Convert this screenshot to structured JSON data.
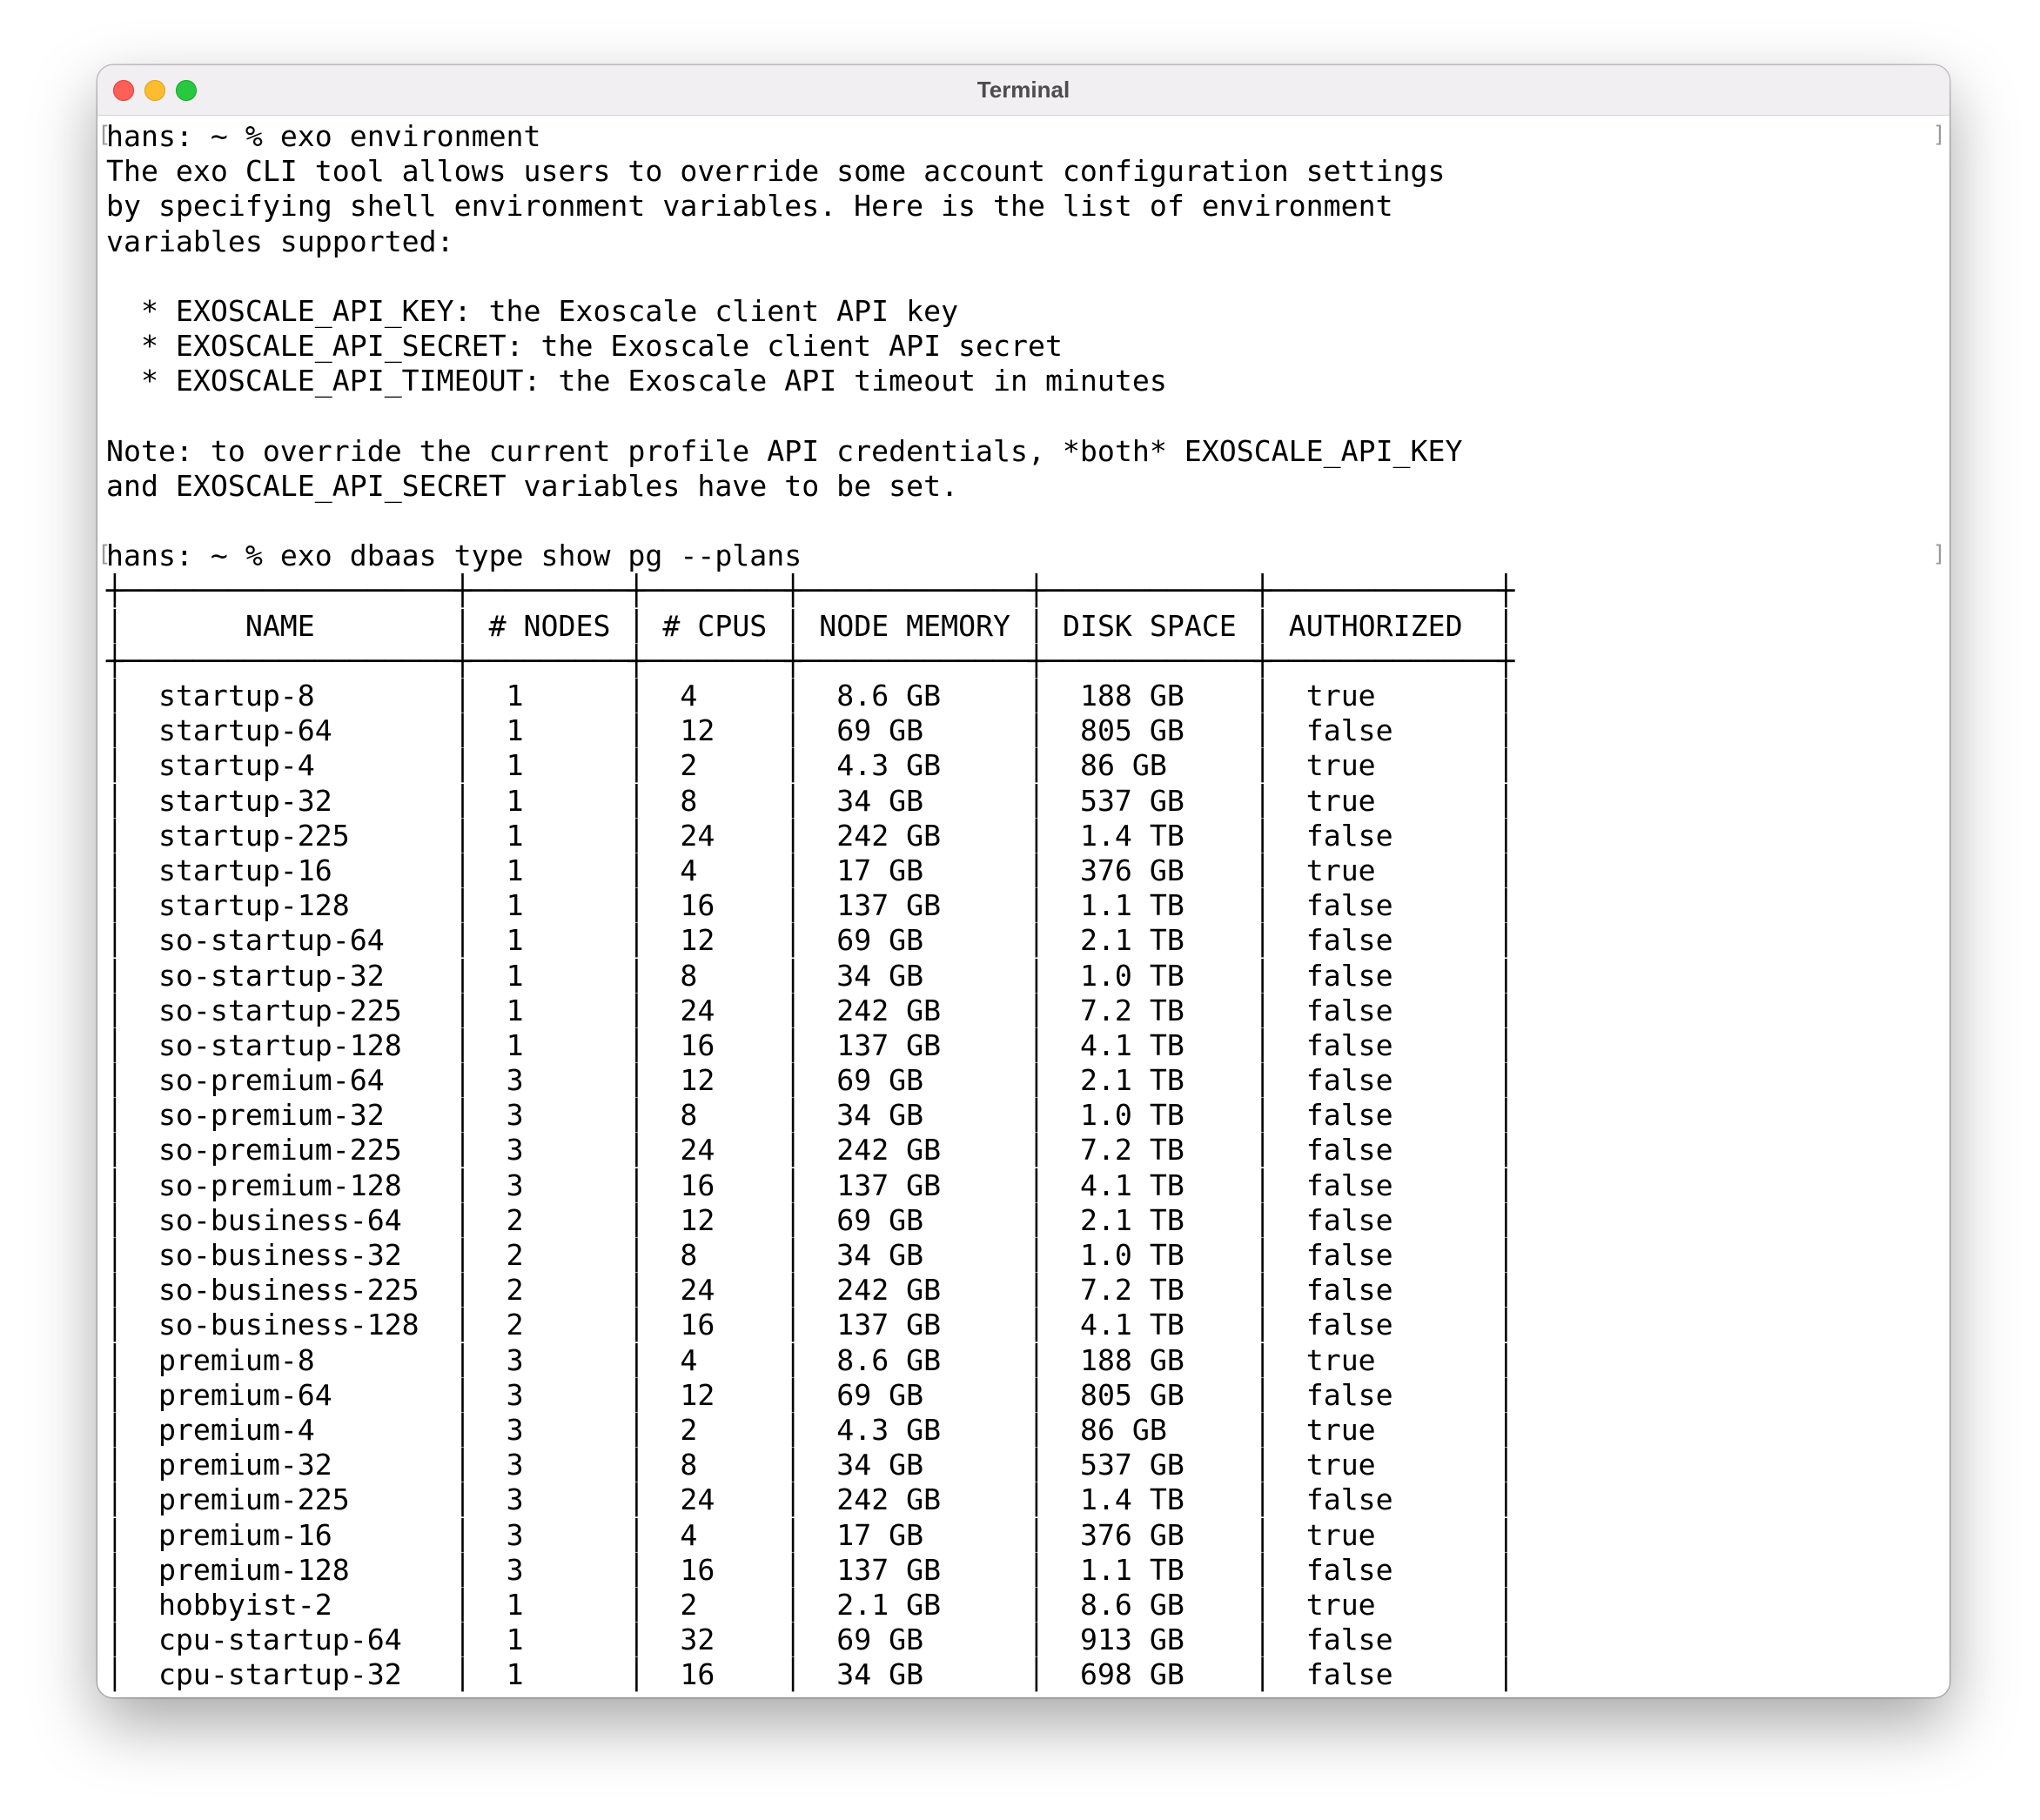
{
  "window": {
    "title": "Terminal"
  },
  "terminal": {
    "prompt1": {
      "prompt": "hans: ~ % ",
      "command": "exo environment"
    },
    "output1": [
      "The exo CLI tool allows users to override some account configuration settings",
      "by specifying shell environment variables. Here is the list of environment",
      "variables supported:",
      "",
      "  * EXOSCALE_API_KEY: the Exoscale client API key",
      "  * EXOSCALE_API_SECRET: the Exoscale client API secret",
      "  * EXOSCALE_API_TIMEOUT: the Exoscale API timeout in minutes",
      "",
      "Note: to override the current profile API credentials, *both* EXOSCALE_API_KEY",
      "and EXOSCALE_API_SECRET variables have to be set.",
      ""
    ],
    "prompt2": {
      "prompt": "hans: ~ % ",
      "command": "exo dbaas type show pg --plans"
    },
    "table": {
      "columns": [
        "NAME",
        "# NODES",
        "# CPUS",
        "NODE MEMORY",
        "DISK SPACE",
        "AUTHORIZED"
      ],
      "rows": [
        [
          "startup-8",
          "1",
          "4",
          "8.6 GB",
          "188 GB",
          "true"
        ],
        [
          "startup-64",
          "1",
          "12",
          "69 GB",
          "805 GB",
          "false"
        ],
        [
          "startup-4",
          "1",
          "2",
          "4.3 GB",
          "86 GB",
          "true"
        ],
        [
          "startup-32",
          "1",
          "8",
          "34 GB",
          "537 GB",
          "true"
        ],
        [
          "startup-225",
          "1",
          "24",
          "242 GB",
          "1.4 TB",
          "false"
        ],
        [
          "startup-16",
          "1",
          "4",
          "17 GB",
          "376 GB",
          "true"
        ],
        [
          "startup-128",
          "1",
          "16",
          "137 GB",
          "1.1 TB",
          "false"
        ],
        [
          "so-startup-64",
          "1",
          "12",
          "69 GB",
          "2.1 TB",
          "false"
        ],
        [
          "so-startup-32",
          "1",
          "8",
          "34 GB",
          "1.0 TB",
          "false"
        ],
        [
          "so-startup-225",
          "1",
          "24",
          "242 GB",
          "7.2 TB",
          "false"
        ],
        [
          "so-startup-128",
          "1",
          "16",
          "137 GB",
          "4.1 TB",
          "false"
        ],
        [
          "so-premium-64",
          "3",
          "12",
          "69 GB",
          "2.1 TB",
          "false"
        ],
        [
          "so-premium-32",
          "3",
          "8",
          "34 GB",
          "1.0 TB",
          "false"
        ],
        [
          "so-premium-225",
          "3",
          "24",
          "242 GB",
          "7.2 TB",
          "false"
        ],
        [
          "so-premium-128",
          "3",
          "16",
          "137 GB",
          "4.1 TB",
          "false"
        ],
        [
          "so-business-64",
          "2",
          "12",
          "69 GB",
          "2.1 TB",
          "false"
        ],
        [
          "so-business-32",
          "2",
          "8",
          "34 GB",
          "1.0 TB",
          "false"
        ],
        [
          "so-business-225",
          "2",
          "24",
          "242 GB",
          "7.2 TB",
          "false"
        ],
        [
          "so-business-128",
          "2",
          "16",
          "137 GB",
          "4.1 TB",
          "false"
        ],
        [
          "premium-8",
          "3",
          "4",
          "8.6 GB",
          "188 GB",
          "true"
        ],
        [
          "premium-64",
          "3",
          "12",
          "69 GB",
          "805 GB",
          "false"
        ],
        [
          "premium-4",
          "3",
          "2",
          "4.3 GB",
          "86 GB",
          "true"
        ],
        [
          "premium-32",
          "3",
          "8",
          "34 GB",
          "537 GB",
          "true"
        ],
        [
          "premium-225",
          "3",
          "24",
          "242 GB",
          "1.4 TB",
          "false"
        ],
        [
          "premium-16",
          "3",
          "4",
          "17 GB",
          "376 GB",
          "true"
        ],
        [
          "premium-128",
          "3",
          "16",
          "137 GB",
          "1.1 TB",
          "false"
        ],
        [
          "hobbyist-2",
          "1",
          "2",
          "2.1 GB",
          "8.6 GB",
          "true"
        ],
        [
          "cpu-startup-64",
          "1",
          "32",
          "69 GB",
          "913 GB",
          "false"
        ],
        [
          "cpu-startup-32",
          "1",
          "16",
          "34 GB",
          "698 GB",
          "false"
        ]
      ]
    }
  }
}
